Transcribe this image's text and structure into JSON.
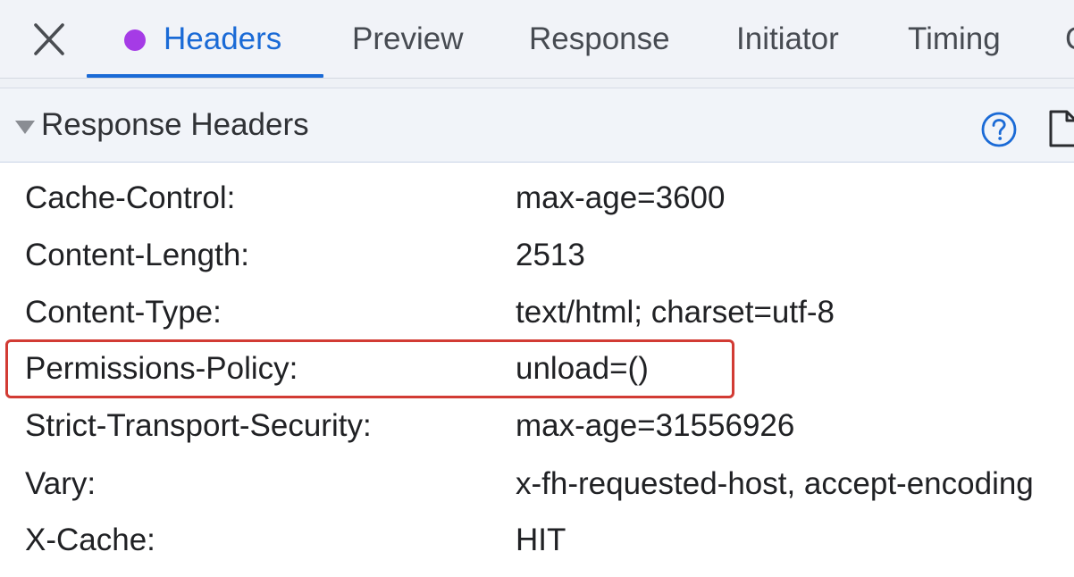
{
  "tabs": [
    {
      "label": "Headers",
      "active": true
    },
    {
      "label": "Preview",
      "active": false
    },
    {
      "label": "Response",
      "active": false
    },
    {
      "label": "Initiator",
      "active": false
    },
    {
      "label": "Timing",
      "active": false
    },
    {
      "label": "C",
      "active": false
    }
  ],
  "colors": {
    "accent": "#1a6ad6",
    "active_dot": "#a53be6",
    "highlight": "#d23b34"
  },
  "section": {
    "title": "Response Headers",
    "expanded": true,
    "icons": [
      "help-icon",
      "file-icon"
    ]
  },
  "headers": [
    {
      "name": "Cache-Control:",
      "value": "max-age=3600"
    },
    {
      "name": "Content-Length:",
      "value": "2513"
    },
    {
      "name": "Content-Type:",
      "value": "text/html; charset=utf-8"
    },
    {
      "name": "Permissions-Policy:",
      "value": "unload=()",
      "highlighted": true
    },
    {
      "name": "Strict-Transport-Security:",
      "value": "max-age=31556926"
    },
    {
      "name": "Vary:",
      "value": "x-fh-requested-host, accept-encoding"
    },
    {
      "name": "X-Cache:",
      "value": "HIT"
    }
  ]
}
